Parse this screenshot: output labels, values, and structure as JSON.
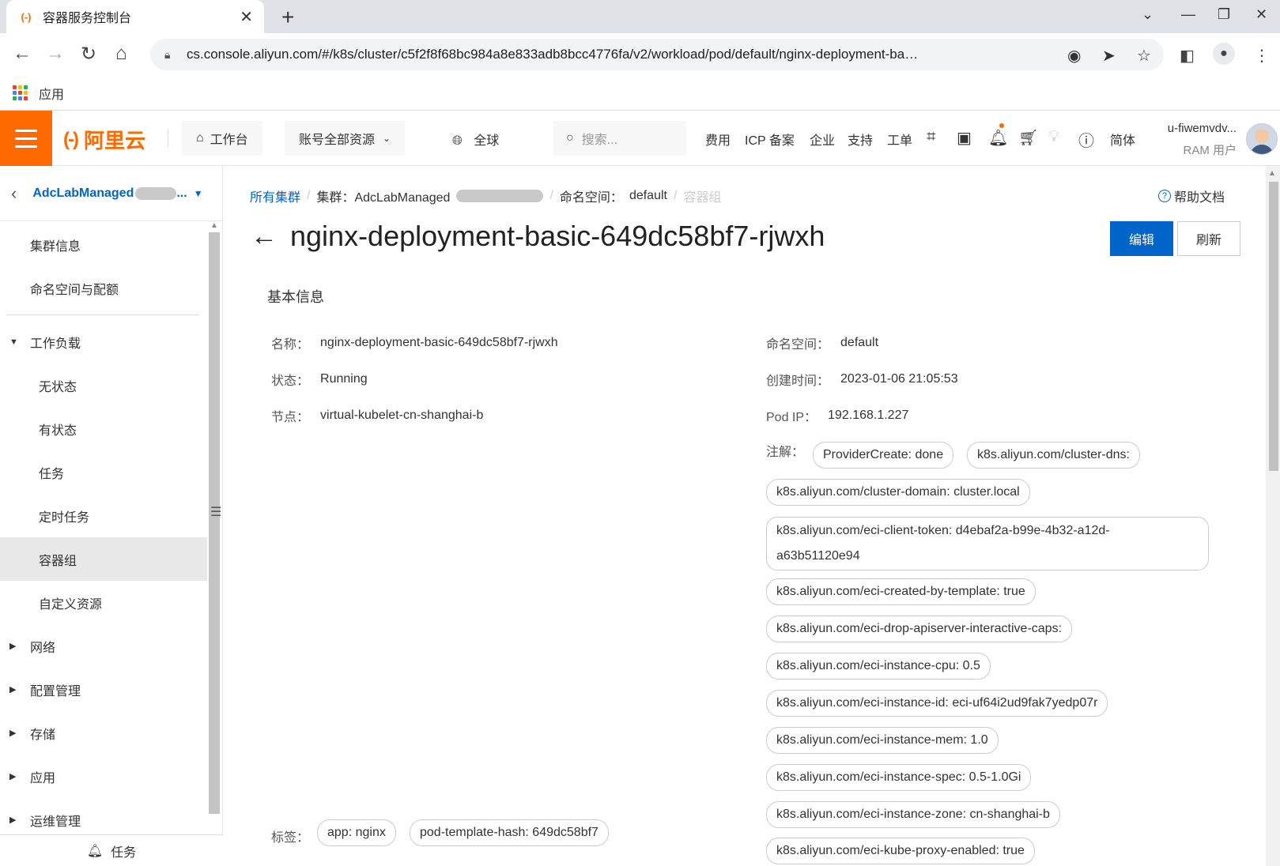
{
  "browser": {
    "tab_title": "容器服务控制台",
    "tab_close": "✕",
    "new_tab": "+",
    "url": "cs.console.aliyun.com/#/k8s/cluster/c5f2f8f68bc984a8e833adb8bcc4776fa/v2/workload/pod/default/nginx-deployment-ba…",
    "bookmark_apps": "应用"
  },
  "topnav": {
    "logo_text": "阿里云",
    "logo_mark": "(-)",
    "workbench": "工作台",
    "all_resources": "账号全部资源",
    "region": "全球",
    "search_placeholder": "搜索...",
    "links": [
      "费用",
      "ICP 备案",
      "企业",
      "支持",
      "工单"
    ],
    "lang": "简体",
    "user_name": "u-fiwemvdv...",
    "user_role": "RAM 用户"
  },
  "sidebar": {
    "cluster_name": "AdcLabManaged",
    "cluster_suffix": "...",
    "items": [
      {
        "label": "集群信息",
        "level": 1
      },
      {
        "label": "命名空间与配额",
        "level": 1
      }
    ],
    "workload_group": "工作负载",
    "workload_items": [
      {
        "label": "无状态"
      },
      {
        "label": "有状态"
      },
      {
        "label": "任务"
      },
      {
        "label": "定时任务"
      },
      {
        "label": "容器组",
        "active": true
      },
      {
        "label": "自定义资源"
      }
    ],
    "groups": [
      "网络",
      "配置管理",
      "存储",
      "应用",
      "运维管理"
    ],
    "footer": "任务"
  },
  "breadcrumb": {
    "all_clusters": "所有集群",
    "cluster_prefix": "集群：AdcLabManaged",
    "namespace_label": "命名空间：",
    "namespace_value": "default",
    "current": "容器组"
  },
  "help_doc": "帮助文档",
  "page": {
    "title": "nginx-deployment-basic-649dc58bf7-rjwxh",
    "edit_button": "编辑",
    "refresh_button": "刷新",
    "section_title": "基本信息"
  },
  "basic_info": {
    "name_label": "名称：",
    "name_value": "nginx-deployment-basic-649dc58bf7-rjwxh",
    "status_label": "状态：",
    "status_value": "Running",
    "node_label": "节点：",
    "node_value": "virtual-kubelet-cn-shanghai-b",
    "namespace_label": "命名空间：",
    "namespace_value": "default",
    "created_label": "创建时间：",
    "created_value": "2023-01-06 21:05:53",
    "podip_label": "Pod IP：",
    "podip_value": "192.168.1.227",
    "annotations_label": "注解：",
    "annotations": [
      "ProviderCreate: done",
      "k8s.aliyun.com/cluster-dns:",
      "k8s.aliyun.com/cluster-domain: cluster.local",
      "k8s.aliyun.com/eci-client-token: d4ebaf2a-b99e-4b32-a12d-",
      "a63b51120e94",
      "k8s.aliyun.com/eci-created-by-template: true",
      "k8s.aliyun.com/eci-drop-apiserver-interactive-caps:",
      "k8s.aliyun.com/eci-instance-cpu: 0.5",
      "k8s.aliyun.com/eci-instance-id: eci-uf64i2ud9fak7yedp07r",
      "k8s.aliyun.com/eci-instance-mem: 1.0",
      "k8s.aliyun.com/eci-instance-spec: 0.5-1.0Gi",
      "k8s.aliyun.com/eci-instance-zone: cn-shanghai-b",
      "k8s.aliyun.com/eci-kube-proxy-enabled: true"
    ],
    "labels_label": "标签：",
    "labels": [
      "app: nginx",
      "pod-template-hash: 649dc58bf7"
    ]
  },
  "colors": {
    "brand_orange": "#ff6a00",
    "primary_blue": "#0064c8"
  }
}
